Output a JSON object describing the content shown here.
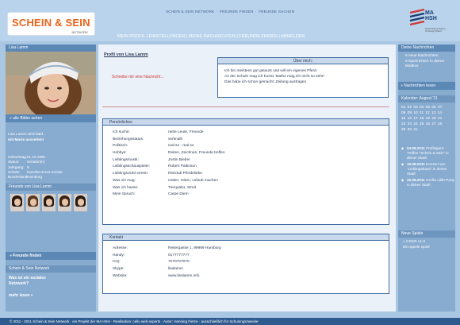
{
  "header": {
    "logo_text": "SCHEIN & SEIN",
    "logo_sub": "NETWORK",
    "top_links": [
      "SCHEIN & SEIN NETWORK",
      "FREUNDE FINDEN",
      "FREUNDE SUCHEN"
    ],
    "main_nav": [
      "MEIN PROFIL",
      "EINSTELLUNGEN",
      "MEINE NACHRICHTEN",
      "FREUNDE FINDEN",
      "ABMELDEN"
    ],
    "mhsh_title": "MA\nHSH",
    "mhsh_sub": "Medienbildung Stiftung Schleswig-Holstein"
  },
  "left": {
    "user_name": "Lisa Lamm",
    "all_photos": "» alle Bilder sehen",
    "status_line1": "Lisa Lamm wird bald...",
    "status_line2": "mit Marie ausreiten!",
    "info": [
      {
        "k": "Geburtstag:",
        "v": "01.10.1998"
      },
      {
        "k": "Status:",
        "v": "Schüler(in)"
      },
      {
        "k": "Jahrgang:",
        "v": "9"
      },
      {
        "k": "Schule:",
        "v": "Karoline-Ernst-Schule"
      },
      {
        "k": "Bundesland:",
        "v": "Hamburg"
      }
    ],
    "friends_title": "Freunde von Lisa Lamm",
    "find_friends": "» Freunde finden",
    "network_title": "Schein & Sein Network",
    "network_q1": "Was ist ein soziales",
    "network_q2": "Netzwerk?",
    "more_info": "mehr lesen »"
  },
  "center": {
    "profile_title": "Profil von Lisa Lamm",
    "write_message": "Schreibe mir eine Nachricht...",
    "about": {
      "title": "Über mich:",
      "lines": [
        "Ich bin meistens gut gelaunt und will ein eigenes Pferd.",
        "An der Schule mag ich Kunst, Mathe mag ich nicht so sehr!",
        "Das habe ich schon gemacht: Zeitung austragen"
      ]
    },
    "personal": {
      "title": "Persönliches",
      "rows": [
        {
          "k": "Ich suche:",
          "v": "nette Leute, Freunde"
        },
        {
          "k": "Beziehungsstatus:",
          "v": "verknallt"
        },
        {
          "k": "Politisch:",
          "v": "mal so - mal so"
        },
        {
          "k": "Hobbys:",
          "v": "Reiten, Zeichnen, Freunde treffen"
        },
        {
          "k": "Lieblingsmusik:",
          "v": "Justin Bieber"
        },
        {
          "k": "Lieblingsschauspieler:",
          "v": "Robert Pattinson"
        },
        {
          "k": "Lieblingsclub/-verein:",
          "v": "Reitclub Pferdeliebe"
        },
        {
          "k": "Was ich mag:",
          "v": "malen, reiten, Urlaub machen"
        },
        {
          "k": "Was ich hasse:",
          "v": "Tierquäler, Streit"
        },
        {
          "k": "Mein Spruch:",
          "v": "Carpe Diem"
        }
      ]
    },
    "contact": {
      "title": "Kontakt",
      "rows": [
        {
          "k": "Adresse:",
          "v": "Reitergasse 1, 99999 Hamburg"
        },
        {
          "k": "Handy:",
          "v": "0177777777"
        },
        {
          "k": "ICQ:",
          "v": "7070707070"
        },
        {
          "k": "Skype:",
          "v": "lisalamm"
        },
        {
          "k": "Website:",
          "v": "www.lisalamm.info"
        }
      ]
    }
  },
  "right": {
    "messages_title": "Deine Nachrichten",
    "msg1": "5 neue Nachrichten",
    "msg2": "5 Nachrichten in deiner Mailbox",
    "read_messages": "» Nachrichten lesen",
    "calendar_title": "Kalender: August '11",
    "calendar_rows": [
      "01 02 03 04 05 06 07",
      "08 09 10 11 12 13 14",
      "15 16 17 18 19 20 21",
      "22 23 24 25 26 27 28",
      "29 30 31"
    ],
    "events": [
      {
        "date": "04.08.2011",
        "text": "Profilagent-Treffen \"Schein & Sein\" in deiner Stadt"
      },
      {
        "date": "16.08.2011",
        "text": "Konzert von \"Lieblingsband\" in deiner Stadt"
      },
      {
        "date": "26.08.2011",
        "text": "Große Lilith-Party in deiner Stadt"
      }
    ],
    "games_title": "Neue Spiele",
    "games": [
      "» CSSG v1.0",
      "Ein Spiele Spiel"
    ]
  },
  "footer": {
    "text": "© 2011 - 2011 Schein & Sein Network  ·  ein Projekt der MA HSH  ·  Realisation: cello web experts  ·  Autor: Henning Fietze  ·  ausschließlich für Schulungszwecke"
  }
}
